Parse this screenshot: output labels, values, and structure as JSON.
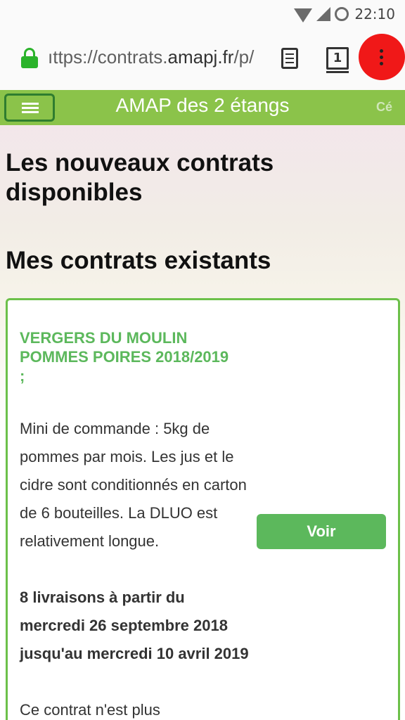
{
  "status_bar": {
    "time": "22:10"
  },
  "browser": {
    "url_prefix": "ıttps://contrats.",
    "url_domain": "amapj.fr",
    "url_suffix": "/p/",
    "tab_count": "1"
  },
  "site": {
    "title": "AMAP des 2 étangs",
    "user_fragment": "Cé"
  },
  "main": {
    "new_contracts_heading": "Les nouveaux contrats disponibles",
    "existing_contracts_heading": "Mes contrats existants"
  },
  "contract": {
    "title": "VERGERS DU MOULIN POMMES POIRES 2018/2019 ;",
    "description": "Mini de commande : 5kg de pommes par mois. Les jus et le cidre sont conditionnés en carton de 6 bouteilles. La DLUO est relativement longue.",
    "dates": "8 livraisons à partir du mercredi 26 septembre 2018 jusqu'au mercredi 10 avril 2019",
    "status": "Ce contrat n'est plus",
    "button_label": "Voir"
  },
  "colors": {
    "header_green": "#8bc34a",
    "accent_green": "#5cb85c",
    "menu_highlight": "#f01818"
  }
}
